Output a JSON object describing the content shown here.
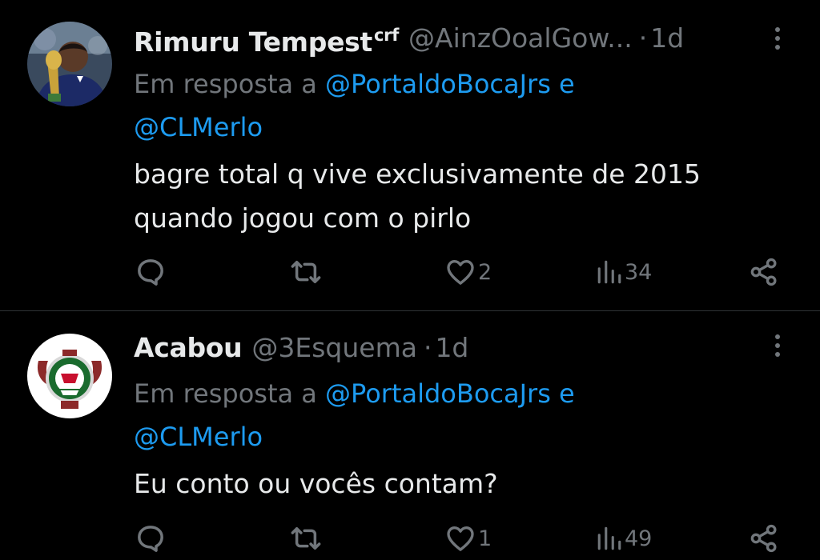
{
  "tweets": [
    {
      "display_name": "Rimuru Tempest",
      "name_suffix": "crf",
      "handle": "@AinzOoalGow...",
      "separator": "·",
      "time": "1d",
      "reply_prefix": "Em resposta a",
      "mention_1": "@PortaldoBocaJrs",
      "mention_joiner": "e",
      "mention_2": "@CLMerlo",
      "text_line_1": "bagre total q vive exclusivamente de 2015",
      "text_line_2": "quando jogou com o pirlo",
      "likes": "2",
      "views": "34"
    },
    {
      "display_name": "Acabou",
      "handle": "@3Esquema",
      "separator": "·",
      "time": "1d",
      "reply_prefix": "Em resposta a",
      "mention_1": "@PortaldoBocaJrs",
      "mention_joiner": "e",
      "mention_2": "@CLMerlo",
      "text_line_1": "Eu conto ou vocês contam?",
      "likes": "1",
      "views": "49"
    }
  ],
  "colors": {
    "background": "#000000",
    "primary_text": "#e7e9ea",
    "secondary_text": "#71767b",
    "link": "#1d9bf0",
    "divider": "#2f3336"
  },
  "icons": {
    "reply": "reply-icon",
    "retweet": "retweet-icon",
    "like": "heart-icon",
    "views": "views-chart-icon",
    "share": "share-icon",
    "more": "more-options-icon"
  }
}
